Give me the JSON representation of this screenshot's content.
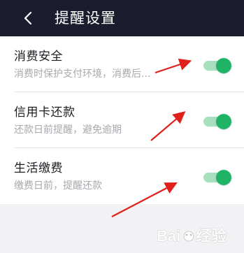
{
  "header": {
    "back_icon": "chevron-left-icon",
    "title": "提醒设置"
  },
  "settings": [
    {
      "title": "消费安全",
      "subtitle": "消费时保护支付环境，消费后...",
      "enabled": true
    },
    {
      "title": "信用卡还款",
      "subtitle": "还款日前提醒，避免逾期",
      "enabled": true
    },
    {
      "title": "生活缴费",
      "subtitle": "缴费日前，提醒还款",
      "enabled": true
    }
  ],
  "colors": {
    "header_bg": "#1b1d2e",
    "toggle_on": "#1fb465",
    "toggle_track": "#a7dfbf",
    "annotation_arrow": "#e0201c"
  },
  "watermark": {
    "text": "Baidu 经验"
  }
}
